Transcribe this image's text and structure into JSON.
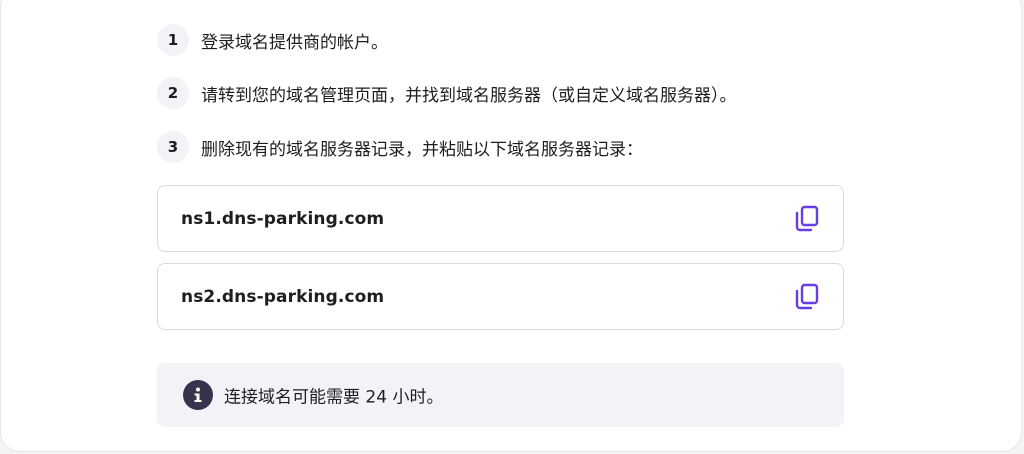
{
  "steps": [
    {
      "number": "1",
      "text": "登录域名提供商的帐户。"
    },
    {
      "number": "2",
      "text": "请转到您的域名管理页面，并找到域名服务器（或自定义域名服务器）。"
    },
    {
      "number": "3",
      "text": "删除现有的域名服务器记录，并粘贴以下域名服务器记录："
    }
  ],
  "nameservers": [
    {
      "value": "ns1.dns-parking.com",
      "icon": "copy-icon"
    },
    {
      "value": "ns2.dns-parking.com",
      "icon": "copy-icon"
    }
  ],
  "info": {
    "icon": "info-icon",
    "text": "连接域名可能需要 24 小时。"
  },
  "colors": {
    "accent": "#673de6",
    "text": "#1d1e20",
    "info_bg": "#f2f3f6",
    "info_icon_bg": "#36344d"
  }
}
